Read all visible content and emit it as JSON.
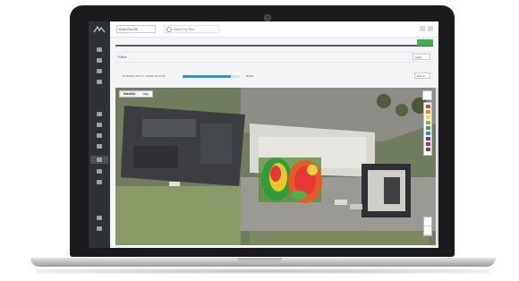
{
  "topbar": {
    "drive_select_value": "Drive Run 28",
    "search_placeholder": "Search by Run..."
  },
  "timeline": {
    "labels": [
      "",
      "",
      "",
      "",
      "",
      "",
      "",
      ""
    ]
  },
  "filter": {
    "label": "Filters",
    "select_value": "Apply"
  },
  "connectivity": {
    "label": "CONNECTIVITY OVER ROUTE",
    "value_text": "84.6%",
    "fill_fraction": 0.84,
    "select_value": "Export"
  },
  "map": {
    "tabs": [
      "Satellite",
      "Map"
    ],
    "legend_colors": [
      "#e53935",
      "#fb8c00",
      "#fdd835",
      "#7cb342",
      "#43a047",
      "#1e88e5",
      "#8e24aa",
      "#d81b60",
      "#6d4c41"
    ]
  },
  "colors": {
    "accent_blue": "#2f8fd8",
    "accent_green": "#3cb34a",
    "sidebar": "#2d3136"
  }
}
